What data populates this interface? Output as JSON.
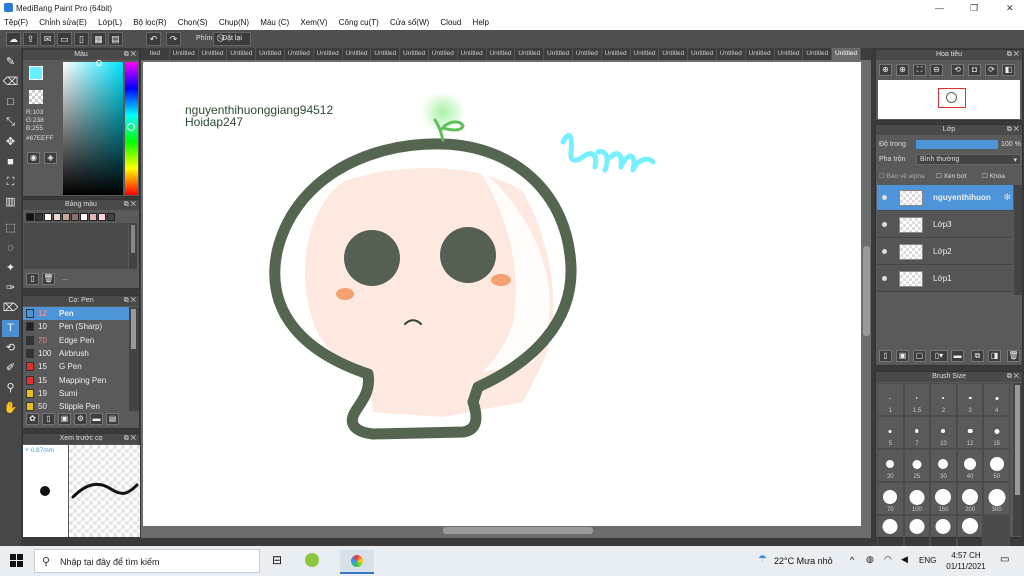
{
  "window": {
    "title": "MediBang Paint Pro (64bit)"
  },
  "menu": [
    "Tệp(F)",
    "Chỉnh sửa(E)",
    "Lớp(L)",
    "Bộ lọc(R)",
    "Chọn(S)",
    "Chụp(N)",
    "Màu (C)",
    "Xem(V)",
    "Công cụ(T)",
    "Cửa sổ(W)",
    "Cloud",
    "Help"
  ],
  "toolbar": {
    "phim_label": "Phím",
    "reset_label": "Đặt lại"
  },
  "color_panel": {
    "title": "Màu",
    "r": "R:103",
    "g": "G:238",
    "b": "B:255",
    "hex": "#67EEFF",
    "current_color": "#67eeff"
  },
  "palette_panel": {
    "title": "Bảng màu",
    "swatches": [
      "#111111",
      "#333333",
      "#ffffff",
      "#e8d8d0",
      "#c8a89a",
      "#8a7070",
      "#ffffff",
      "#e0b8b8",
      "#ffd0d8",
      "#444444"
    ],
    "more": "..."
  },
  "brush_panel": {
    "title": "Cọ: Pen",
    "items": [
      {
        "size": "12",
        "name": "Pen",
        "color": "#4d95d8"
      },
      {
        "size": "10",
        "name": "Pen (Sharp)",
        "color": "#222222"
      },
      {
        "size": "70",
        "name": "Edge Pen",
        "color": "#333333"
      },
      {
        "size": "100",
        "name": "Airbrush",
        "color": "#333333"
      },
      {
        "size": "15",
        "name": "G Pen",
        "color": "#e03030"
      },
      {
        "size": "15",
        "name": "Mapping Pen",
        "color": "#e03030"
      },
      {
        "size": "19",
        "name": "Sumi",
        "color": "#e8c020"
      },
      {
        "size": "50",
        "name": "Stipple Pen",
        "color": "#e8c020"
      }
    ]
  },
  "preview_panel": {
    "title": "Xem trước cọ",
    "size": "0.87mm"
  },
  "tabs": [
    "tled",
    "Untitled",
    "Untitled",
    "Untitled",
    "Untitled",
    "Untitled",
    "Untitled",
    "Untitled",
    "Untitled",
    "Untitled",
    "Untitled",
    "Untitled",
    "Untitled",
    "Untitled",
    "Untitled",
    "Untitled",
    "Untitled",
    "Untitled",
    "Untitled",
    "Untitled",
    "Untitled",
    "Untitled",
    "Untitled",
    "Untitled",
    "Untitled"
  ],
  "canvas": {
    "text_line1": "nguyenthihuonggiang94512",
    "text_line2": "Hoidap247"
  },
  "navigator": {
    "title": "Hoa tiêu"
  },
  "layer_panel": {
    "title": "Lớp",
    "opacity_label": "Độ trong",
    "opacity_value": "100 %",
    "opacity_fraction": 1.0,
    "blend_label": "Pha trộn",
    "blend_value": "Bình thường",
    "protect_alpha": "Bảo vệ alpha",
    "clipping": "Xén bớt",
    "lock": "Khóa",
    "layers": [
      "nguyenthihuon",
      "Lớp3",
      "Lớp2",
      "Lớp1"
    ]
  },
  "brush_size_panel": {
    "title": "Brush Size",
    "sizes": [
      "1",
      "1.5",
      "2",
      "3",
      "4",
      "5",
      "7",
      "10",
      "12",
      "15",
      "20",
      "25",
      "30",
      "40",
      "50",
      "70",
      "100",
      "150",
      "200",
      "300",
      "",
      "",
      "",
      "",
      ""
    ]
  },
  "taskbar": {
    "search_placeholder": "Nhập tại đây để tìm kiếm",
    "weather": "22°C  Mưa nhỏ",
    "lang": "ENG",
    "time": "4:57 CH",
    "date": "01/11/2021"
  },
  "colors": {
    "skull_outline": "#556650",
    "skull_shade": "#fde9df",
    "cheek": "#f5a070",
    "sprout": "#5fbf5a",
    "scribble": "#67eeff",
    "accent": "#4d95d8"
  }
}
